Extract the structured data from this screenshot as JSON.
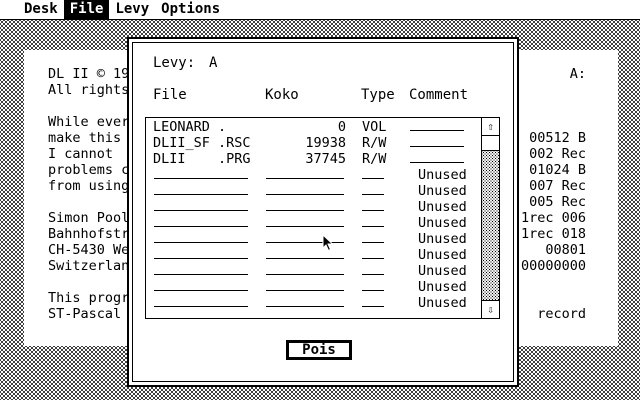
{
  "menubar": {
    "items": [
      {
        "label": "Desk",
        "active": false
      },
      {
        "label": "File",
        "active": true
      },
      {
        "label": "Levy",
        "active": false
      },
      {
        "label": "Options",
        "active": false
      }
    ]
  },
  "background_window": {
    "left_lines": [
      "DL II © 19",
      "All rights",
      "",
      "While ever",
      "make this",
      "I cannot",
      "problems c",
      "from using",
      "",
      "Simon Pool",
      "Bahnhofstr",
      "CH-5430 We",
      "Switzerlan",
      "",
      "This progr",
      "ST-Pascal"
    ],
    "right_lines": [
      "A:",
      "",
      "",
      "",
      "00512 B",
      "002 Rec",
      "01024 B",
      "007 Rec",
      "005 Rec",
      "1rec 006",
      "1rec 018",
      "00801",
      "00000000",
      "",
      "",
      "record"
    ]
  },
  "dialog": {
    "drive_label": "Levy:",
    "drive_value": "A",
    "columns": {
      "file": "File",
      "size": "Koko",
      "type": "Type",
      "comment": "Comment"
    },
    "rows": [
      {
        "name": "LEONARD",
        "ext": ".",
        "size": "0",
        "type": "VOL",
        "comment": "",
        "empty": false
      },
      {
        "name": "DLII_SF",
        "ext": ".RSC",
        "size": "19938",
        "type": "R/W",
        "comment": "",
        "empty": false
      },
      {
        "name": "DLII",
        "ext": ".PRG",
        "size": "37745",
        "type": "R/W",
        "comment": "",
        "empty": false
      },
      {
        "name": "",
        "ext": "",
        "size": "",
        "type": "",
        "comment": "Unused",
        "empty": true
      },
      {
        "name": "",
        "ext": "",
        "size": "",
        "type": "",
        "comment": "Unused",
        "empty": true
      },
      {
        "name": "",
        "ext": "",
        "size": "",
        "type": "",
        "comment": "Unused",
        "empty": true
      },
      {
        "name": "",
        "ext": "",
        "size": "",
        "type": "",
        "comment": "Unused",
        "empty": true
      },
      {
        "name": "",
        "ext": "",
        "size": "",
        "type": "",
        "comment": "Unused",
        "empty": true
      },
      {
        "name": "",
        "ext": "",
        "size": "",
        "type": "",
        "comment": "Unused",
        "empty": true
      },
      {
        "name": "",
        "ext": "",
        "size": "",
        "type": "",
        "comment": "Unused",
        "empty": true
      },
      {
        "name": "",
        "ext": "",
        "size": "",
        "type": "",
        "comment": "Unused",
        "empty": true
      },
      {
        "name": "",
        "ext": "",
        "size": "",
        "type": "",
        "comment": "Unused",
        "empty": true
      }
    ],
    "ok_label": "Pois",
    "scroll_up_icon": "arrow-up-icon",
    "scroll_down_icon": "arrow-down-icon"
  }
}
